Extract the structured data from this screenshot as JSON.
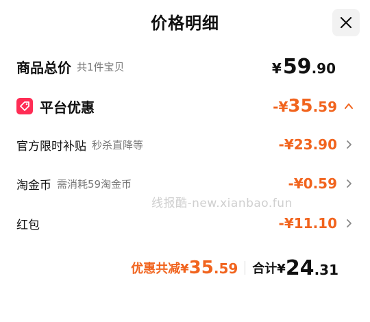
{
  "header": {
    "title": "价格明细"
  },
  "items_total": {
    "label": "商品总价",
    "sub": "共1件宝贝",
    "symbol": "¥",
    "int": "59",
    "dec": ".90"
  },
  "platform": {
    "label": "平台优惠",
    "prefix": "-¥",
    "int": "35",
    "dec": ".59"
  },
  "rows": [
    {
      "label": "官方限时补贴",
      "sub": "秒杀直降等",
      "amount": "-¥23.90"
    },
    {
      "label": "淘金币",
      "sub": "需消耗59淘金币",
      "amount": "-¥0.59"
    },
    {
      "label": "红包",
      "sub": "",
      "amount": "-¥11.10"
    }
  ],
  "footer": {
    "discount_label": "优惠共减¥",
    "discount_int": "35",
    "discount_dec": ".59",
    "total_label": "合计¥",
    "total_int": "24",
    "total_dec": ".31"
  },
  "watermark": "线报酷-new.xianbao.fun",
  "colors": {
    "accent": "#f1641e",
    "badge": "#ff2d55"
  },
  "icons": {
    "close": "close-icon",
    "coupon": "coupon-tag-icon",
    "chevron_up": "chevron-up-icon",
    "chevron_right": "chevron-right-icon"
  }
}
